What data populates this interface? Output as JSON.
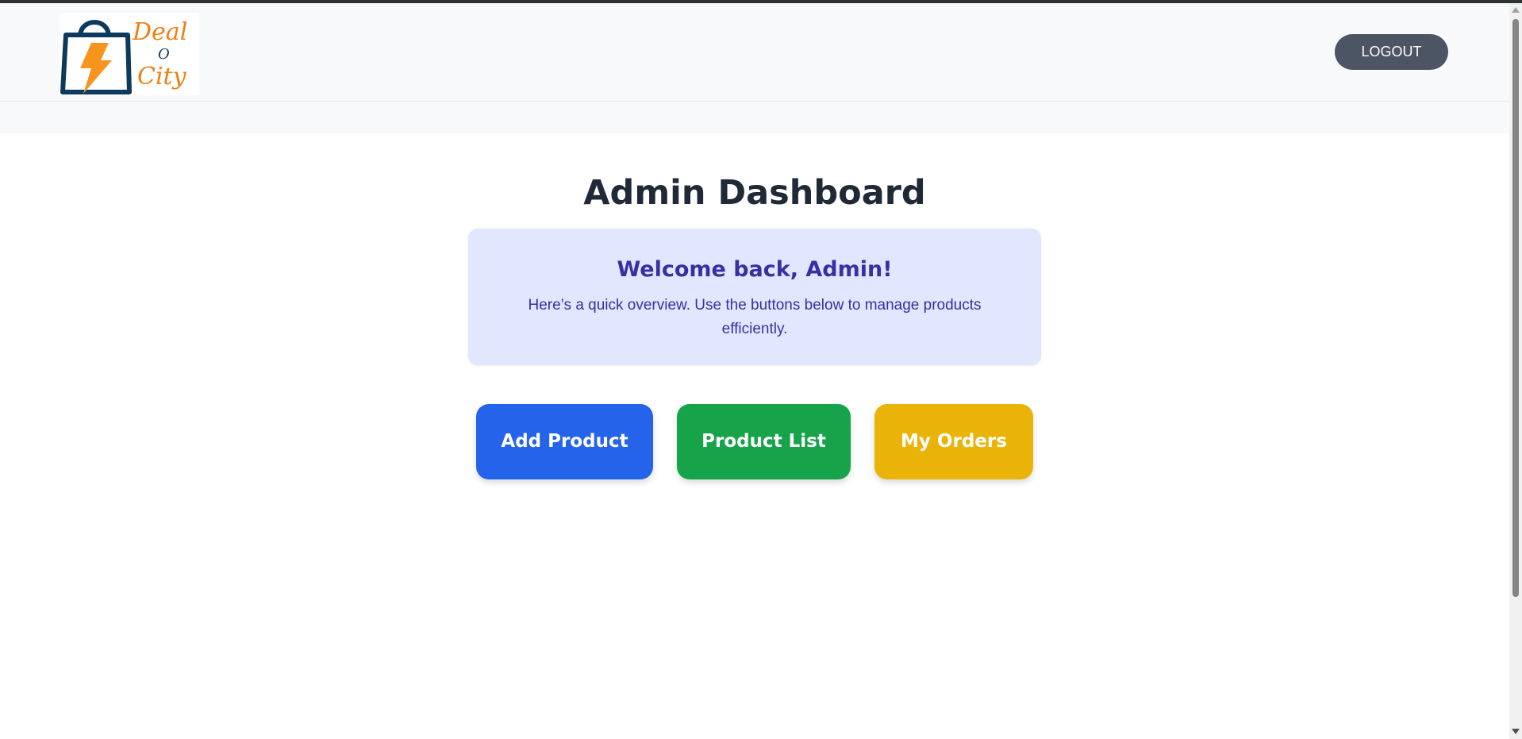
{
  "header": {
    "logo": {
      "word_top": "Deal",
      "word_middle": "O",
      "word_bottom": "City",
      "icon": "shopping-bag-lightning-icon",
      "bag_color": "#0b3a5e",
      "bolt_color": "#f7941d",
      "text_color": "#f07f12"
    },
    "logout_label": "LOGOUT"
  },
  "main": {
    "title": "Admin Dashboard",
    "welcome": {
      "heading": "Welcome back, Admin!",
      "text": "Here’s a quick overview. Use the buttons below to manage products efficiently."
    },
    "actions": [
      {
        "label": "Add Product",
        "color": "#2563eb"
      },
      {
        "label": "Product List",
        "color": "#16a34a"
      },
      {
        "label": "My Orders",
        "color": "#eab308"
      }
    ]
  },
  "colors": {
    "header_bg": "#f8f9fb",
    "logout_bg": "#4b5563",
    "title": "#1f2937",
    "card_bg": "#e0e7ff",
    "card_text": "#3730a3"
  }
}
